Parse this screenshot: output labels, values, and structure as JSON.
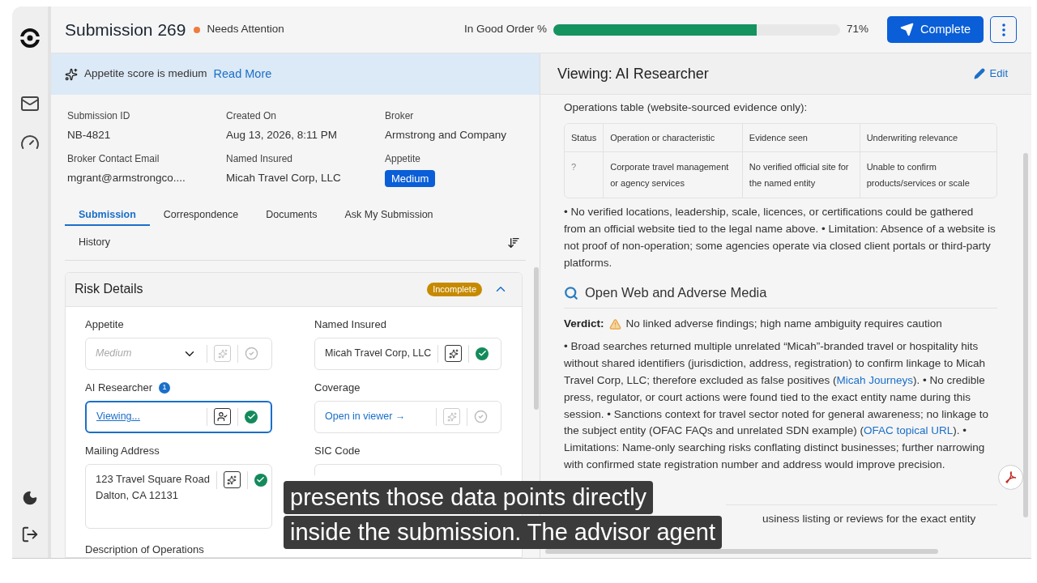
{
  "header": {
    "title": "Submission 269",
    "status": {
      "label": "Needs Attention",
      "color": "#f07b3f"
    },
    "progress": {
      "label": "In Good Order %",
      "level": 0.71,
      "reading": "71%"
    },
    "complete_button": "Complete"
  },
  "banner": {
    "text": "Appetite score is medium",
    "link": "Read More"
  },
  "info": [
    {
      "label": "Submission ID",
      "value": "NB-4821",
      "kind": "text"
    },
    {
      "label": "Created On",
      "value": "Aug 13, 2026, 8:11 PM",
      "kind": "text"
    },
    {
      "label": "Broker",
      "value": "Armstrong and Company",
      "kind": "text"
    },
    {
      "label": "Broker Contact Email",
      "value": "mgrant@armstrongco....",
      "kind": "text"
    },
    {
      "label": "Named Insured",
      "value": "Micah Travel Corp, LLC",
      "kind": "text"
    },
    {
      "label": "Appetite",
      "value": "Medium",
      "kind": "badge"
    }
  ],
  "tabs": [
    {
      "label": "Submission",
      "selected": true
    },
    {
      "label": "Correspondence",
      "selected": false
    },
    {
      "label": "Documents",
      "selected": false
    },
    {
      "label": "Ask My Submission",
      "selected": false
    },
    {
      "label": "History",
      "selected": false
    }
  ],
  "risk_details": {
    "title": "Risk Details",
    "badge": "Incomplete",
    "expanded": true,
    "fields": [
      {
        "label": "Appetite",
        "kind": "select",
        "placeholder": "Medium",
        "ai_applied": false,
        "verified": false,
        "focused": false
      },
      {
        "label": "Named Insured",
        "kind": "text",
        "value": "Micah Travel Corp, LLC",
        "ai_applied": true,
        "verified": true,
        "focused": false
      },
      {
        "label": "AI Researcher",
        "count": "1",
        "kind": "viewer",
        "value": "Viewing...",
        "ai_applied": true,
        "verified": true,
        "focused": true
      },
      {
        "label": "Coverage",
        "kind": "link",
        "value": "Open in viewer →",
        "ai_applied": false,
        "verified": false,
        "focused": false
      },
      {
        "label": "Mailing Address",
        "kind": "address",
        "lines": [
          "123 Travel Square Road",
          "Dalton, CA 12131"
        ],
        "ai_applied": true,
        "verified": true,
        "focused": false
      },
      {
        "label": "SIC Code",
        "kind": "empty",
        "focused": false
      }
    ],
    "next_label": "Description of Operations"
  },
  "viewer": {
    "title": "Viewing: AI Researcher",
    "edit": "Edit",
    "table_caption": "Operations table (website-sourced evidence only):",
    "table": {
      "columns": [
        "Status",
        "Operation or characteristic",
        "Evidence seen",
        "Underwriting relevance"
      ],
      "rows": [
        [
          "?",
          "Corporate travel management or agency services",
          "No verified official site for the named entity",
          "Unable to confirm products/services or scale"
        ]
      ]
    },
    "paragraph_1": [
      {
        "text": "• No verified locations, leadership, scale, licences, or certifications could be gathered from an official website tied to the legal name above. • Limitation: Absence of a website is not proof of non-operation; some agencies operate via closed client portals or third-party platforms.",
        "kind": "text"
      }
    ],
    "section_title": "Open Web and Adverse Media",
    "verdict": {
      "label": "Verdict:",
      "text": "No linked adverse findings; high name ambiguity requires caution"
    },
    "paragraph_2": [
      {
        "text": "• Broad searches returned multiple unrelated “Micah”-branded travel or hospitality hits without shared identifiers (jurisdiction, address, registration) to confirm linkage to Micah Travel Corp, LLC; therefore excluded as false positives (",
        "kind": "text"
      },
      {
        "text": "Micah Journeys",
        "kind": "link"
      },
      {
        "text": "). • No credible press, regulator, or court actions were found tied to the exact entity name during this session. • Sanctions context for travel sector noted for general awareness; no linkage to the subject entity (OFAC FAQs and unrelated SDN example) (",
        "kind": "text"
      },
      {
        "text": "OFAC topical URL",
        "kind": "link"
      },
      {
        "text": "). • Limitations: Name-only searching risks conflating distinct businesses; further narrowing with confirmed state registration number and address would improve precision.",
        "kind": "text"
      }
    ],
    "last_line": "usiness listing or reviews for the exact entity"
  },
  "caption": [
    "presents those data points directly",
    "inside the submission. The advisor agent"
  ]
}
